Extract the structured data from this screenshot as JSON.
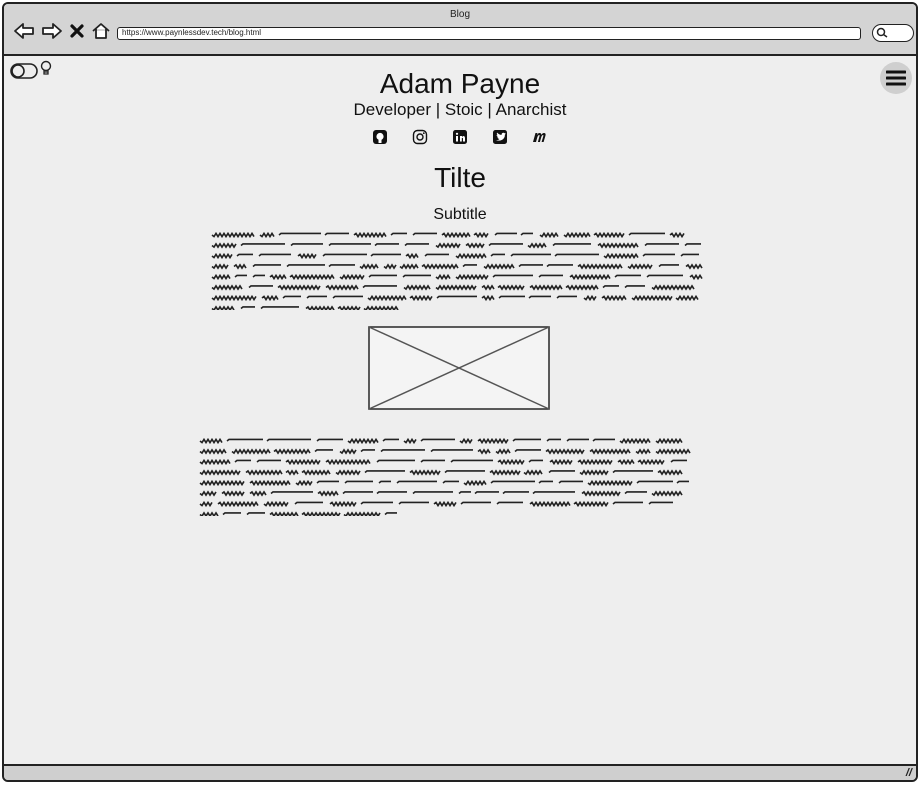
{
  "window": {
    "title": "Blog"
  },
  "address_bar": {
    "url": "https://www.paynlessdev.tech/blog.html"
  },
  "icons": {
    "back": "back-arrow-icon",
    "forward": "forward-arrow-icon",
    "stop": "close-icon",
    "home": "home-icon",
    "search": "search-icon",
    "theme_toggle": "toggle-switch-icon",
    "bulb": "lightbulb-icon",
    "menu": "hamburger-menu-icon",
    "image": "image-placeholder-icon",
    "resize": "resize-grip-icon"
  },
  "header": {
    "author": "Adam Payne",
    "tagline": "Developer | Stoic | Anarchist",
    "socials": [
      "github-icon",
      "instagram-icon",
      "linkedin-icon",
      "twitter-icon",
      "medium-icon"
    ]
  },
  "post": {
    "title": "Tilte",
    "subtitle": "Subtitle"
  }
}
